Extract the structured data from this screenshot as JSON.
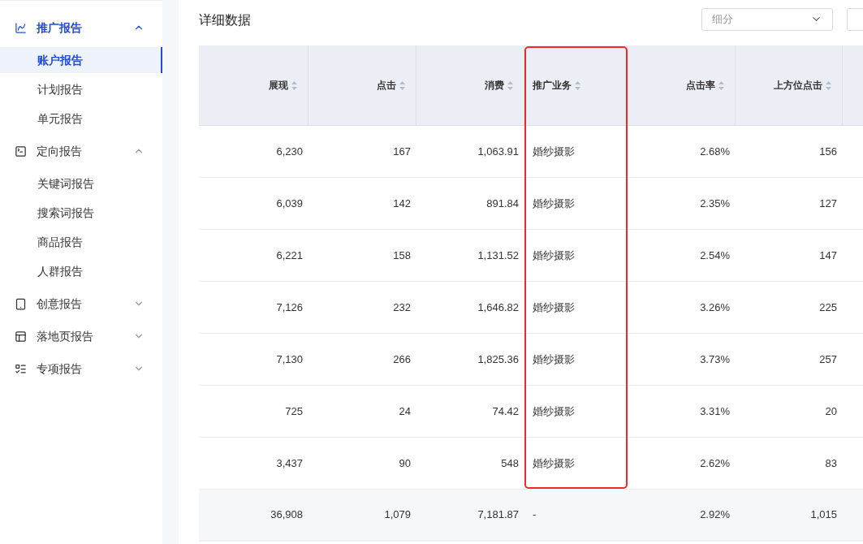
{
  "sidebar": {
    "groups": [
      {
        "label": "推广报告",
        "expanded": true,
        "active": true,
        "items": [
          {
            "label": "账户报告",
            "selected": true
          },
          {
            "label": "计划报告",
            "selected": false
          },
          {
            "label": "单元报告",
            "selected": false
          }
        ]
      },
      {
        "label": "定向报告",
        "expanded": true,
        "active": false,
        "items": [
          {
            "label": "关键词报告",
            "selected": false
          },
          {
            "label": "搜索词报告",
            "selected": false
          },
          {
            "label": "商品报告",
            "selected": false
          },
          {
            "label": "人群报告",
            "selected": false
          }
        ]
      },
      {
        "label": "创意报告",
        "expanded": false,
        "active": false
      },
      {
        "label": "落地页报告",
        "expanded": false,
        "active": false
      },
      {
        "label": "专项报告",
        "expanded": false,
        "active": false
      }
    ]
  },
  "section_title": "详细数据",
  "breakdown_select": {
    "placeholder": "细分"
  },
  "table": {
    "columns": [
      {
        "label": "展现",
        "kind": "number",
        "highlighted": false
      },
      {
        "label": "点击",
        "kind": "number",
        "highlighted": false
      },
      {
        "label": "消费",
        "kind": "number",
        "highlighted": false
      },
      {
        "label": "推广业务",
        "kind": "text",
        "highlighted": true
      },
      {
        "label": "点击率",
        "kind": "number",
        "highlighted": false
      },
      {
        "label": "上方位点击",
        "kind": "number",
        "highlighted": false
      }
    ],
    "rows": [
      [
        "6,230",
        "167",
        "1,063.91",
        "婚纱摄影",
        "2.68%",
        "156"
      ],
      [
        "6,039",
        "142",
        "891.84",
        "婚纱摄影",
        "2.35%",
        "127"
      ],
      [
        "6,221",
        "158",
        "1,131.52",
        "婚纱摄影",
        "2.54%",
        "147"
      ],
      [
        "7,126",
        "232",
        "1,646.82",
        "婚纱摄影",
        "3.26%",
        "225"
      ],
      [
        "7,130",
        "266",
        "1,825.36",
        "婚纱摄影",
        "3.73%",
        "257"
      ],
      [
        "725",
        "24",
        "74.42",
        "婚纱摄影",
        "3.31%",
        "20"
      ],
      [
        "3,437",
        "90",
        "548",
        "婚纱摄影",
        "2.62%",
        "83"
      ]
    ],
    "total_row": [
      "36,908",
      "1,079",
      "7,181.87",
      "-",
      "2.92%",
      "1,015"
    ]
  }
}
